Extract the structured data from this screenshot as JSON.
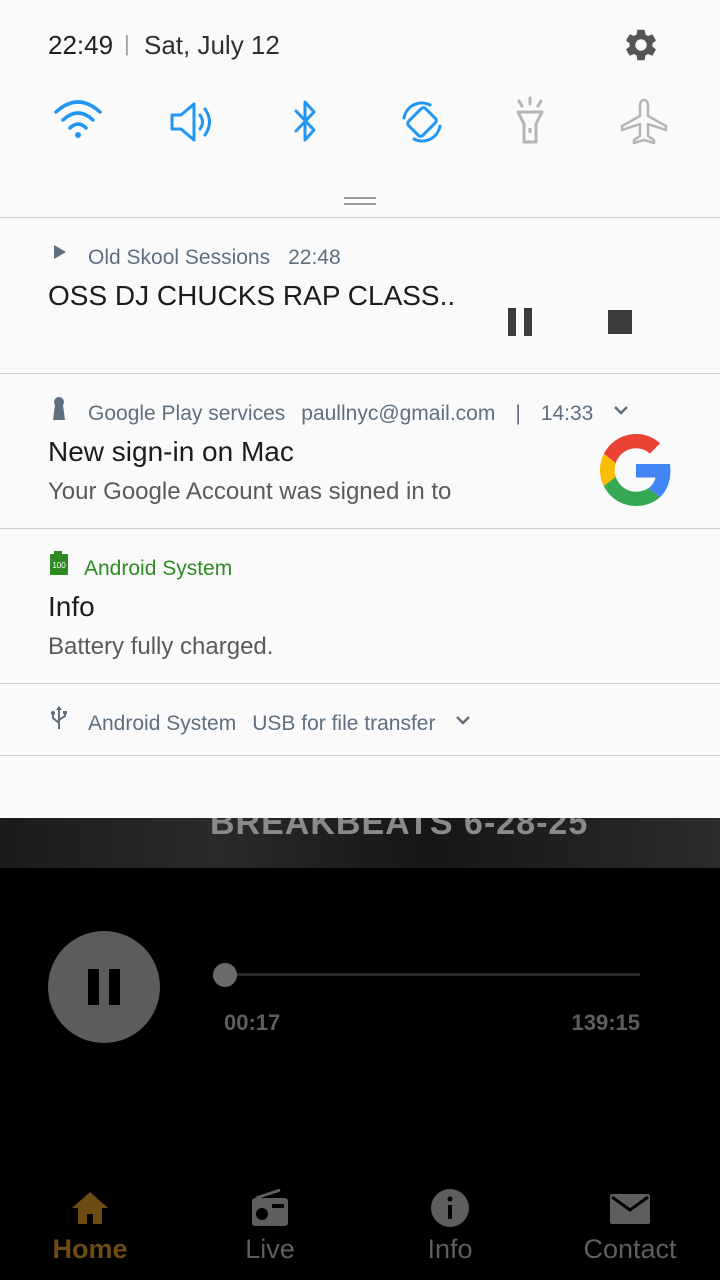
{
  "status_bar": {
    "time": "22:49",
    "separator": "|",
    "date": "Sat, July 12"
  },
  "quick_settings": [
    {
      "name": "wifi",
      "on": true
    },
    {
      "name": "sound",
      "on": true
    },
    {
      "name": "bluetooth",
      "on": true
    },
    {
      "name": "auto-rotate",
      "on": true
    },
    {
      "name": "flashlight",
      "on": false
    },
    {
      "name": "airplane-mode",
      "on": false
    }
  ],
  "colors": {
    "accent": "#2196f3",
    "inactive": "#b5b5b5",
    "android_green": "#2e8b24",
    "brand_active": "#6e4a14"
  },
  "media_notification": {
    "app": "Old Skool Sessions",
    "time": "22:48",
    "title": "OSS DJ CHUCKS RAP CLASS.."
  },
  "google_notification": {
    "app": "Google Play services",
    "account": "paullnyc@gmail.com",
    "separator": "|",
    "time": "14:33",
    "title": "New sign-in on Mac",
    "text": "Your Google Account was signed in to"
  },
  "battery_notification": {
    "battery_badge": "100",
    "app": "Android System",
    "title": "Info",
    "text": "Battery fully charged."
  },
  "usb_notification": {
    "app": "Android System",
    "text": "USB for file transfer"
  },
  "player": {
    "banner_text": "BREAKBEATS 6-28-25",
    "current_time": "00:17",
    "total_time": "139:15",
    "progress": 0.0
  },
  "tabs": [
    {
      "label": "Home",
      "icon": "home-icon",
      "active": true
    },
    {
      "label": "Live",
      "icon": "radio-icon",
      "active": false
    },
    {
      "label": "Info",
      "icon": "info-icon",
      "active": false
    },
    {
      "label": "Contact",
      "icon": "mail-icon",
      "active": false
    }
  ]
}
